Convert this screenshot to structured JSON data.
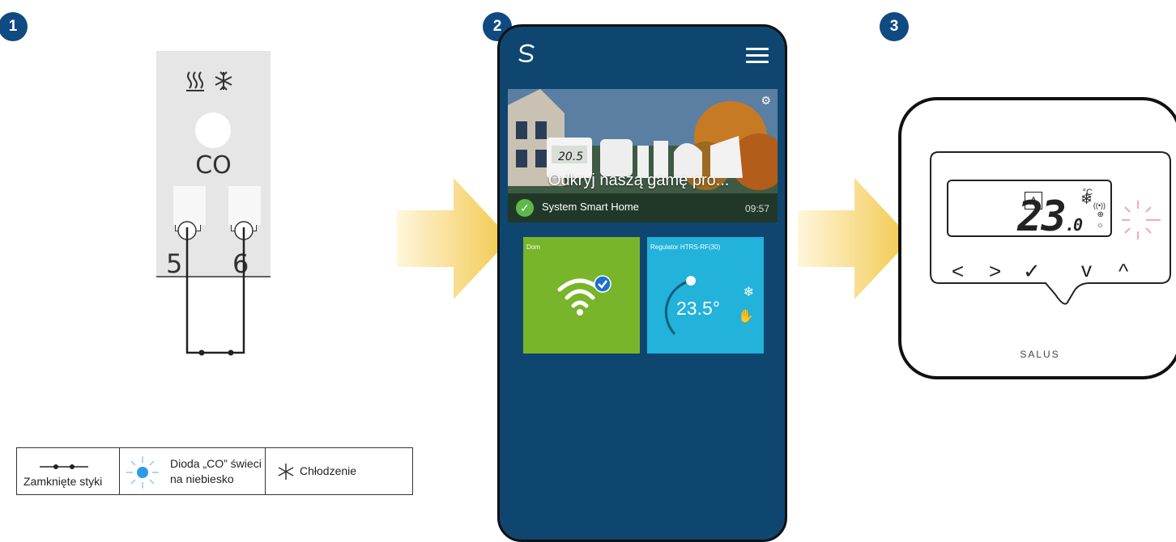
{
  "steps": [
    "1",
    "2",
    "3"
  ],
  "module": {
    "label": "CO",
    "terminals": [
      "5",
      "6"
    ]
  },
  "legend": {
    "closed_contacts": "Zamknięte styki",
    "led_line1": "Dioda „CO” świeci",
    "led_line2": "na niebiesko",
    "cooling": "Chłodzenie"
  },
  "phone": {
    "banner_title": "Odkryj naszą gamę pro...",
    "banner_status": "System Smart Home",
    "banner_time": "09:57",
    "tile_home_label": "Dom",
    "tile_regulator_label": "Regulator HTRS-RF(30)",
    "tile_regulator_temp": "23.5°"
  },
  "thermostat": {
    "mode": "A",
    "temp": "23",
    "decimal": ".0",
    "unit": "°C",
    "brand": "SALUS",
    "buttons": [
      "<",
      ">",
      "✓",
      "v",
      "^"
    ]
  },
  "colors": {
    "badge": "#0f4a82",
    "phone_bg": "#0e4670",
    "tile_green": "#78b52a",
    "tile_cyan": "#22b2da",
    "arrow": "#f2c84b"
  }
}
